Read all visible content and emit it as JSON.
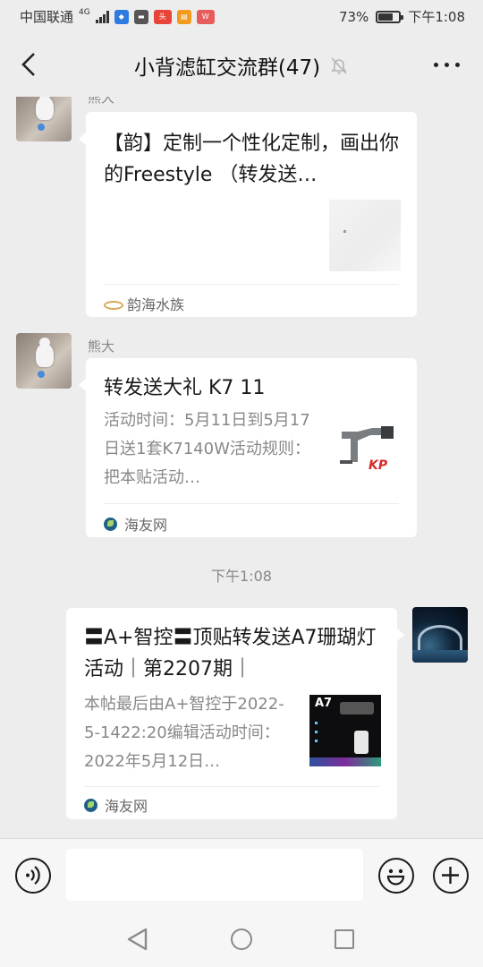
{
  "status_bar": {
    "carrier": "中国联通",
    "network": "4G",
    "battery_percent": "73%",
    "battery_level": 0.73,
    "time": "下午1:08"
  },
  "header": {
    "title": "小背滤缸交流群(47)"
  },
  "messages": [
    {
      "sender": "熊大",
      "card": {
        "title": "【韵】定制一个性化定制，画出你的Freestyle （转发送…",
        "source": "韵海水族"
      }
    },
    {
      "sender": "熊大",
      "card": {
        "title": "转发送大礼 K7 11",
        "description": "活动时间：5月11日到5月17日送1套K7140W活动规则：把本贴活动…",
        "thumb_text": "KP",
        "source": "海友网"
      }
    }
  ],
  "timestamp": "下午1:08",
  "own_message": {
    "card": {
      "title": "〓A+智控〓顶贴转发送A7珊瑚灯活动｜第2207期｜",
      "description": "本帖最后由A+智控于2022-5-1422:20编辑活动时间：2022年5月12日…",
      "thumb_text": "A7",
      "source": "海友网"
    }
  },
  "input": {
    "value": ""
  }
}
